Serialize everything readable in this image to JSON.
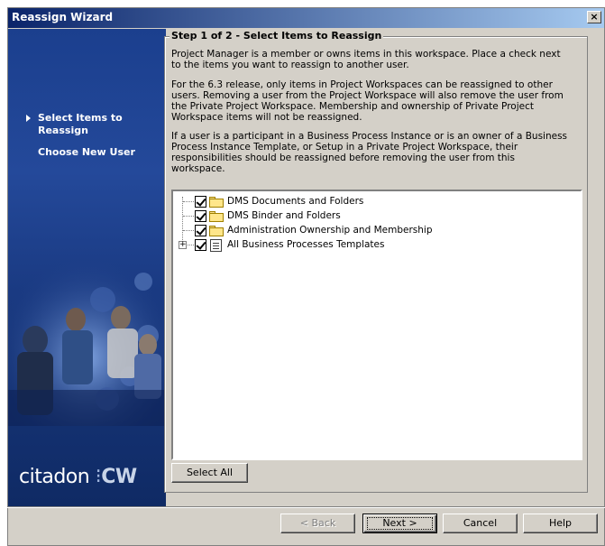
{
  "window": {
    "title": "Reassign Wizard",
    "close_label": "×"
  },
  "sidebar": {
    "steps": [
      {
        "label": "Select Items to Reassign",
        "active": true
      },
      {
        "label": "Choose New User",
        "active": false
      }
    ],
    "logo": {
      "text": "citadon",
      "suffix": "CW"
    }
  },
  "main": {
    "group_title": "Step 1 of 2 - Select Items to Reassign",
    "paragraphs": [
      "Project Manager is a member or owns items in this workspace. Place a check next to the items you want to reassign to another user.",
      "For the 6.3 release, only items in Project Workspaces can be reassigned to other users.  Removing a user from the Project Workspace will also remove the user from the Private Project Workspace.  Membership and ownership of Private Project Workspace items will not be reassigned.",
      "If a user is a participant in a Business Process Instance or is an owner of a Business Process Instance Template, or Setup in a Private Project Workspace, their responsibilities should be reassigned before removing the user from this workspace."
    ],
    "tree_items": [
      {
        "label": "DMS Documents and Folders",
        "icon": "folder-icon",
        "checked": true,
        "expandable": false
      },
      {
        "label": "DMS Binder and Folders",
        "icon": "folder-icon",
        "checked": true,
        "expandable": false
      },
      {
        "label": "Administration Ownership and Membership",
        "icon": "folder-icon",
        "checked": true,
        "expandable": false
      },
      {
        "label": "All Business Processes Templates",
        "icon": "document-icon",
        "checked": true,
        "expandable": true
      }
    ],
    "select_all_label": "Select All"
  },
  "footer": {
    "back_label": "< Back",
    "next_label": "Next >",
    "cancel_label": "Cancel",
    "help_label": "Help"
  }
}
